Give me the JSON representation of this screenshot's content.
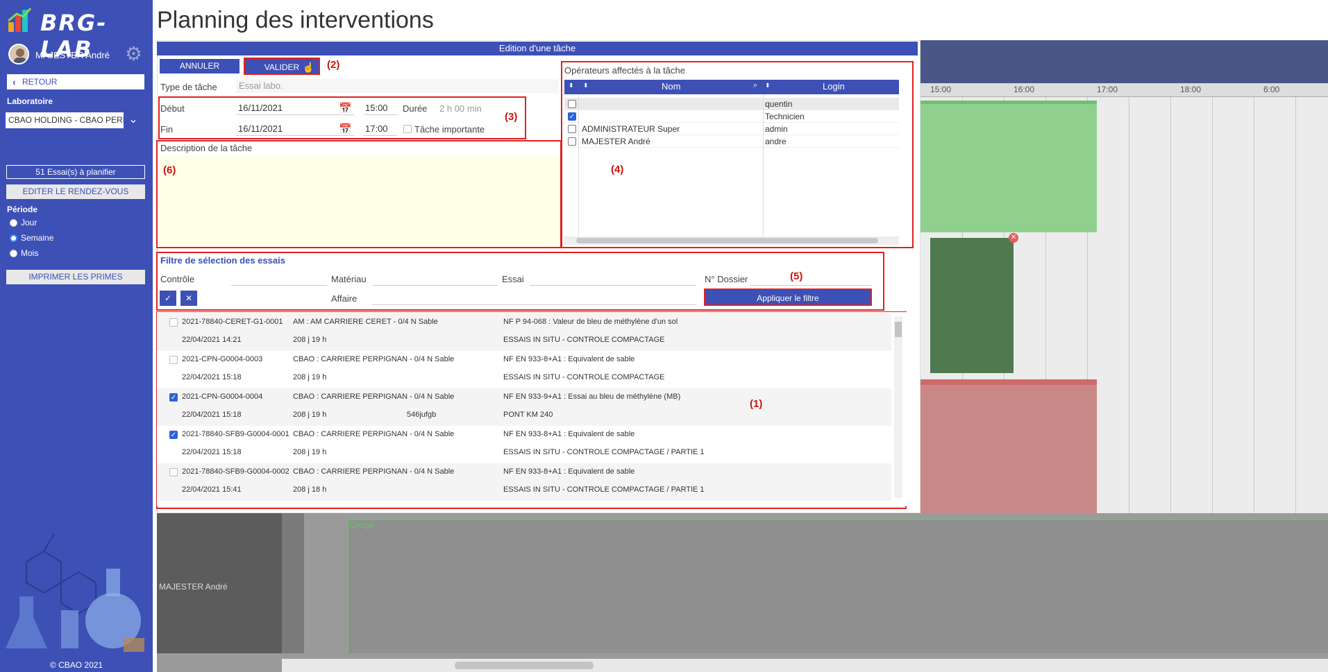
{
  "app": {
    "logo_text": "BRG-LAB",
    "user_name": "MAJESTER André",
    "retour_label": "RETOUR",
    "laboratoire_label": "Laboratoire",
    "laboratoire_value": "CBAO HOLDING - CBAO PERPIGNAN",
    "essais_btn": "51 Essai(s) à planifier",
    "editer_btn": "EDITER LE RENDEZ-VOUS",
    "periode_label": "Période",
    "periode_options": [
      "Jour",
      "Semaine",
      "Mois"
    ],
    "periode_selected": "Semaine",
    "imprimer_btn": "IMPRIMER LES PRIMES",
    "copyright": "© CBAO 2021"
  },
  "page": {
    "title": "Planning des interventions"
  },
  "timeline": {
    "hours": [
      "15:00",
      "16:00",
      "17:00",
      "18:00",
      "6:00"
    ],
    "resource_name": "MAJESTER André",
    "conge_label": "Congé"
  },
  "modal": {
    "header": "Edition d'une tâche",
    "annuler": "ANNULER",
    "valider": "VALIDER",
    "type_label": "Type de tâche",
    "type_value": "Essai labo.",
    "debut_label": "Début",
    "debut_date": "16/11/2021",
    "debut_time": "15:00",
    "duree_label": "Durée",
    "duree_value": "2 h 00 min",
    "fin_label": "Fin",
    "fin_date": "16/11/2021",
    "fin_time": "17:00",
    "importante_label": "Tâche importante",
    "description_label": "Description de la tâche",
    "operators": {
      "title": "Opérateurs affectés à la tâche",
      "col_nom": "Nom",
      "col_login": "Login",
      "rows": [
        {
          "nom": "",
          "login": "quentin",
          "checked": false
        },
        {
          "nom": "",
          "login": "Technicien",
          "checked": true
        },
        {
          "nom": "ADMINISTRATEUR Super",
          "login": "admin",
          "checked": false
        },
        {
          "nom": "MAJESTER André",
          "login": "andre",
          "checked": false
        }
      ]
    },
    "filter": {
      "title": "Filtre de sélection des essais",
      "controle_label": "Contrôle",
      "materiau_label": "Matériau",
      "essai_label": "Essai",
      "dossier_label": "N° Dossier",
      "affaire_label": "Affaire",
      "apply_btn": "Appliquer le filtre"
    },
    "tests": [
      {
        "ref": "2021-78840-CERET-G1-0001",
        "date": "22/04/2021 14:21",
        "client": "AM : AM CARRIERE CERET - 0/4 N Sable",
        "delay": "208 j 19 h",
        "extra": "",
        "norme": "NF P 94-068 : Valeur de bleu de méthylène d'un sol",
        "site": "ESSAIS IN SITU - CONTROLE COMPACTAGE",
        "checked": false
      },
      {
        "ref": "2021-CPN-G0004-0003",
        "date": "22/04/2021 15:18",
        "client": "CBAO : CARRIERE PERPIGNAN - 0/4 N Sable",
        "delay": "208 j 19 h",
        "extra": "",
        "norme": "NF EN 933-8+A1 : Equivalent de sable",
        "site": "ESSAIS IN SITU - CONTROLE COMPACTAGE",
        "checked": false
      },
      {
        "ref": "2021-CPN-G0004-0004",
        "date": "22/04/2021 15:18",
        "client": "CBAO : CARRIERE PERPIGNAN - 0/4 N Sable",
        "delay": "208 j 19 h",
        "extra": "546jufgb",
        "norme": "NF EN 933-9+A1 : Essai au bleu de méthylène (MB)",
        "site": "PONT KM 240",
        "checked": true
      },
      {
        "ref": "2021-78840-SFB9-G0004-0001",
        "date": "22/04/2021 15:18",
        "client": "CBAO : CARRIERE PERPIGNAN - 0/4 N Sable",
        "delay": "208 j 19 h",
        "extra": "",
        "norme": "NF EN 933-8+A1 : Equivalent de sable",
        "site": "ESSAIS IN SITU - CONTROLE COMPACTAGE / PARTIE 1",
        "checked": true
      },
      {
        "ref": "2021-78840-SFB9-G0004-0002",
        "date": "22/04/2021 15:41",
        "client": "CBAO : CARRIERE PERPIGNAN - 0/4 N Sable",
        "delay": "208 j 18 h",
        "extra": "",
        "norme": "NF EN 933-8+A1 : Equivalent de sable",
        "site": "ESSAIS IN SITU - CONTROLE COMPACTAGE / PARTIE 1",
        "checked": false
      }
    ],
    "annotations": {
      "a1": "(1)",
      "a2": "(2)",
      "a3": "(3)",
      "a4": "(4)",
      "a5": "(5)",
      "a6": "(6)"
    }
  },
  "colors": {
    "sidebar": "#3d50b6",
    "accent": "#3d50b6",
    "annotation": "#e02020"
  }
}
